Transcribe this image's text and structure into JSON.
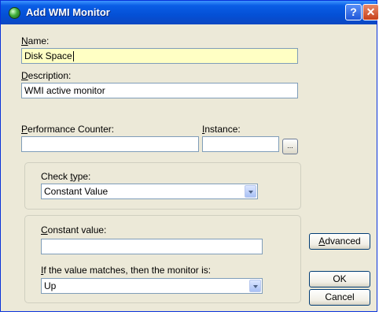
{
  "window": {
    "title": "Add WMI Monitor",
    "help_glyph": "?",
    "close_glyph": "✕"
  },
  "form": {
    "name_label": "Name:",
    "name_value": "Disk Space",
    "description_label": "Description:",
    "description_value": "WMI active monitor",
    "counter_label": "Performance Counter:",
    "counter_value": "",
    "instance_label": "Instance:",
    "instance_value": "",
    "browse_label": "..."
  },
  "check_group": {
    "check_type_label": "Check type:",
    "check_type_selected": "Constant Value"
  },
  "value_group": {
    "constant_label": "Constant value:",
    "constant_value": "",
    "match_label": "If the value matches, then the monitor is:",
    "match_selected": "Up"
  },
  "buttons": {
    "advanced": "Advanced",
    "ok": "OK",
    "cancel": "Cancel"
  },
  "colors": {
    "title_bar": "#0a5ee6",
    "dialog_bg": "#ece9d8",
    "focused_field": "#ffffc4"
  }
}
